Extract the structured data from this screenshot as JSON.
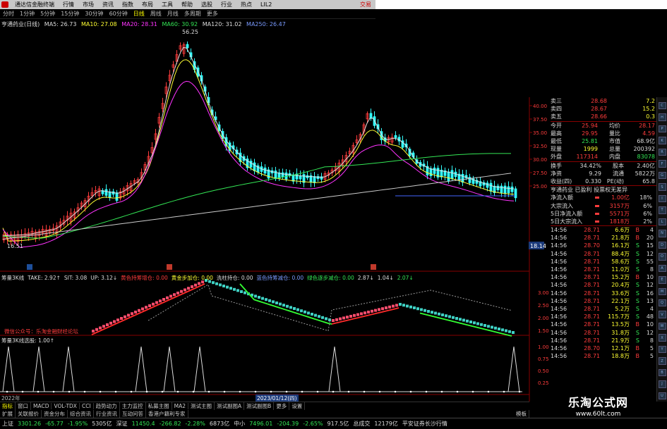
{
  "app": {
    "menus": [
      "分时",
      "行情",
      "市场",
      "资讯",
      "指数",
      "布局",
      "工具",
      "帮助",
      "选股",
      "行业",
      "热点",
      "LIL2"
    ],
    "title": "通达信金融终端",
    "trade": "交易"
  },
  "periods": [
    "分时",
    "1分钟",
    "5分钟",
    "15分钟",
    "30分钟",
    "60分钟",
    "日线",
    "周线",
    "月线",
    "多周期",
    "更多"
  ],
  "active_period": "日线",
  "main_info": {
    "name": "亨通药业(日线)",
    "ma5": "MA5: 26.73",
    "ma10": "MA10: 27.08",
    "ma20": "MA20: 28.31",
    "ma60": "MA60: 30.92",
    "ma120": "MA120: 31.02",
    "ma250": "MA250: 26.47",
    "high_label": "56.25",
    "low_label": "16.51",
    "current_tag": "18.14"
  },
  "price_axis": [
    "40.00",
    "37.50",
    "35.00",
    "32.50",
    "30.00",
    "27.50",
    "25.00"
  ],
  "ind1": {
    "title": "筹量3K线",
    "items": [
      {
        "t": "TAKE: 2.92↑",
        "c": "white"
      },
      {
        "t": "SIT: 3.08",
        "c": "white"
      },
      {
        "t": "UP: 3.12↓",
        "c": "white"
      },
      {
        "t": "黄色持筹增仓: 0.00",
        "c": "red"
      },
      {
        "t": "黄金步加仓: 0.00",
        "c": "yellow"
      },
      {
        "t": "洗柱持仓: 0.00",
        "c": "white"
      },
      {
        "t": "蓝色持筹减仓: 0.00",
        "c": "blue"
      },
      {
        "t": "绿色逐步减仓: 0.00",
        "c": "green"
      },
      {
        "t": "2.87↓",
        "c": "white"
      },
      {
        "t": "1.04↓",
        "c": "white"
      },
      {
        "t": "2.07↓",
        "c": "green"
      }
    ],
    "note": "微信公众号：乐淘金融财经论坛",
    "axis": [
      "3.00",
      "2.50",
      "2.00",
      "1.50"
    ]
  },
  "ind2": {
    "title": "筹量3K线选股:",
    "value": "1.00↑",
    "axis": [
      "1.00",
      "0.75",
      "0.50",
      "0.25"
    ],
    "date_start": "2022年",
    "date_mid": "2023/01/12(四)"
  },
  "tabs_row1": [
    "指标",
    "窗口",
    "MACD",
    "VOL-TDX",
    "CCI",
    "趋势动力",
    "主力监控",
    "私募主图",
    "MA2",
    "测试主图",
    "测试副图A",
    "测试副图B",
    "更多",
    "设置"
  ],
  "tabs_row2": [
    "扩展",
    "关联报价",
    "资金分布",
    "综合资讯",
    "行业资讯",
    "互动问答",
    "香港户籍利专家"
  ],
  "tab_right": "模板",
  "watermark": {
    "cn": "乐淘公式网",
    "url": "www.60lt.com"
  },
  "quote": {
    "rows": [
      {
        "l": "卖三",
        "p": "28.68",
        "v": "7.2"
      },
      {
        "l": "卖四",
        "p": "28.67",
        "v": "15.2"
      },
      {
        "l": "卖五",
        "p": "28.66",
        "v": "0.3"
      }
    ],
    "stats": [
      [
        "今开",
        "25.94",
        "均价",
        "28.17"
      ],
      [
        "最高",
        "29.95",
        "量比",
        "4.59"
      ],
      [
        "最低",
        "25.81",
        "市值",
        "68.9亿"
      ],
      [
        "现量",
        "1999",
        "总量",
        "200392"
      ],
      [
        "外盘",
        "117314",
        "内盘",
        "83078"
      ]
    ],
    "stats2": [
      [
        "换手",
        "34.42%",
        "股本",
        "2.40亿"
      ],
      [
        "净资",
        "9.29",
        "流通",
        "5822万"
      ],
      [
        "收益(四)",
        "0.330",
        "PE(动)",
        "65.8"
      ]
    ],
    "company": "亨通药业 已盈利 投票权无差异",
    "flows": [
      {
        "l": "净流入额",
        "v": "1.00亿",
        "p": "18%"
      },
      {
        "l": "大宗流入",
        "v": "3157万",
        "p": "6%"
      },
      {
        "l": "5日净流入额",
        "v": "5571万",
        "p": "6%"
      },
      {
        "l": "5日大宗流入",
        "v": "1818万",
        "p": "2%"
      }
    ],
    "trades": [
      [
        "14:56",
        "28.71",
        "6.6万",
        "B",
        "4"
      ],
      [
        "14:56",
        "28.71",
        "21.8万",
        "B",
        "20"
      ],
      [
        "14:56",
        "28.70",
        "16.1万",
        "S",
        "15"
      ],
      [
        "14:56",
        "28.71",
        "88.4万",
        "S",
        "12"
      ],
      [
        "14:56",
        "28.71",
        "58.6万",
        "S",
        "55"
      ],
      [
        "14:56",
        "28.71",
        "11.0万",
        "S",
        "8"
      ],
      [
        "14:56",
        "28.71",
        "15.2万",
        "B",
        "10"
      ],
      [
        "14:56",
        "28.71",
        "20.4万",
        "S",
        "12"
      ],
      [
        "14:56",
        "28.71",
        "33.6万",
        "S",
        "16"
      ],
      [
        "14:56",
        "28.71",
        "22.1万",
        "S",
        "13"
      ],
      [
        "14:56",
        "28.71",
        "5.2万",
        "S",
        "4"
      ],
      [
        "14:56",
        "28.71",
        "115.7万",
        "S",
        "48"
      ],
      [
        "14:56",
        "28.71",
        "13.5万",
        "B",
        "10"
      ],
      [
        "14:56",
        "28.71",
        "31.8万",
        "S",
        "12"
      ],
      [
        "14:56",
        "28.71",
        "21.9万",
        "S",
        "8"
      ],
      [
        "14:56",
        "28.70",
        "12.1万",
        "B",
        "5"
      ],
      [
        "14:56",
        "28.71",
        "18.8万",
        "B",
        "5"
      ]
    ]
  },
  "status": {
    "sh_label": "上证",
    "sh_idx": "3301.26",
    "sh_chg": "-65.77",
    "sh_pct": "-1.95%",
    "sh_amt": "5305亿",
    "sz_label": "深证",
    "sz_idx": "11450.4",
    "sz_chg": "-266.82",
    "sz_pct": "-2.28%",
    "sz_amt": "6873亿",
    "zx_label": "中小",
    "zx_idx": "7496.01",
    "zx_chg": "-204.39",
    "zx_pct": "-2.65%",
    "zx_amt": "917.5亿",
    "vol_label": "总成交",
    "vol": "12179亿",
    "right": "平安证券长沙行情"
  },
  "colors": {
    "up": "#ff3c3c",
    "down": "#33e655",
    "flat": "#ddd",
    "accent": "#ffff33",
    "bg": "#000000"
  }
}
